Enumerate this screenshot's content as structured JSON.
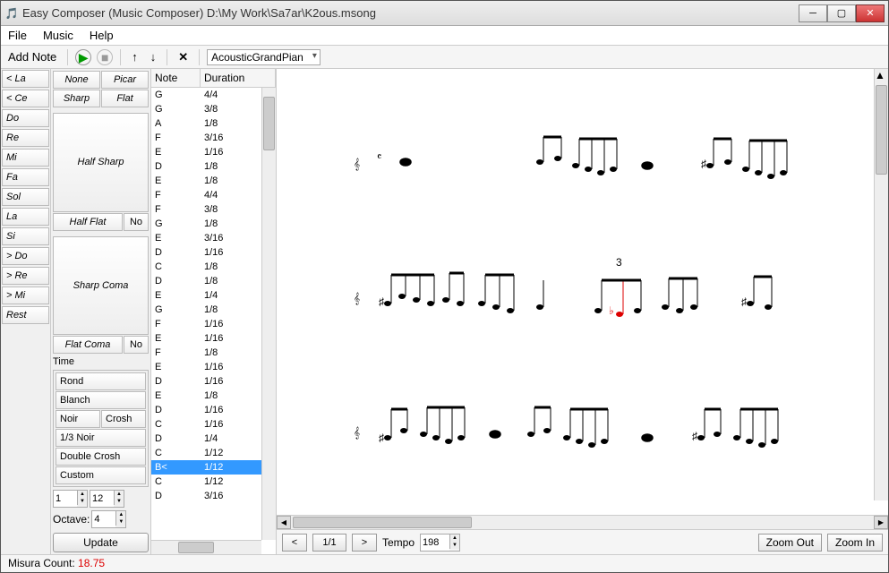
{
  "window": {
    "title": "Easy Composer (Music Composer) D:\\My Work\\Sa7ar\\K2ous.msong"
  },
  "menu": {
    "file": "File",
    "music": "Music",
    "help": "Help"
  },
  "toolbar": {
    "add_note": "Add Note",
    "instrument": "AcousticGrandPian"
  },
  "notes_left": [
    "< La",
    "< Ce",
    "Do",
    "Re",
    "Mi",
    "Fa",
    "Sol",
    "La",
    "Si",
    "> Do",
    "> Re",
    "> Mi",
    "Rest"
  ],
  "props": {
    "none": "None",
    "picar": "Picar",
    "sharp": "Sharp",
    "flat": "Flat",
    "half_sharp": "Half Sharp",
    "half_flat": "Half Flat",
    "no": "No",
    "sharp_coma": "Sharp Coma",
    "flat_coma": "Flat Coma",
    "time_label": "Time",
    "time_items": [
      "Rond",
      "Blanch"
    ],
    "time_row": [
      "Noir",
      "Crosh"
    ],
    "time_items2": [
      "1/3 Noir",
      "Double Crosh",
      "Custom"
    ],
    "num1": "1",
    "num2": "12",
    "octave_label": "Octave:",
    "octave": "4",
    "update": "Update"
  },
  "table": {
    "col_note": "Note",
    "col_dur": "Duration",
    "rows": [
      {
        "n": "G",
        "d": "4/4"
      },
      {
        "n": "G",
        "d": "3/8"
      },
      {
        "n": "A",
        "d": "1/8"
      },
      {
        "n": "F",
        "d": "3/16"
      },
      {
        "n": "E",
        "d": "1/16"
      },
      {
        "n": "D",
        "d": "1/8"
      },
      {
        "n": "E",
        "d": "1/8"
      },
      {
        "n": "F",
        "d": "4/4"
      },
      {
        "n": "F",
        "d": "3/8"
      },
      {
        "n": "G",
        "d": "1/8"
      },
      {
        "n": "E",
        "d": "3/16"
      },
      {
        "n": "D",
        "d": "1/16"
      },
      {
        "n": "C",
        "d": "1/8"
      },
      {
        "n": "D",
        "d": "1/8"
      },
      {
        "n": "E",
        "d": "1/4"
      },
      {
        "n": "G",
        "d": "1/8"
      },
      {
        "n": "F",
        "d": "1/16"
      },
      {
        "n": "E",
        "d": "1/16"
      },
      {
        "n": "F",
        "d": "1/8"
      },
      {
        "n": "E",
        "d": "1/16"
      },
      {
        "n": "D",
        "d": "1/16"
      },
      {
        "n": "E",
        "d": "1/8"
      },
      {
        "n": "D",
        "d": "1/16"
      },
      {
        "n": "C",
        "d": "1/16"
      },
      {
        "n": "D",
        "d": "1/4"
      },
      {
        "n": "C",
        "d": "1/12"
      },
      {
        "n": "B<",
        "d": "1/12",
        "sel": true
      },
      {
        "n": "C",
        "d": "1/12"
      },
      {
        "n": "D",
        "d": "3/16"
      }
    ]
  },
  "bottom": {
    "page": "1/1",
    "tempo_label": "Tempo",
    "tempo": "198",
    "zoom_out": "Zoom Out",
    "zoom_in": "Zoom In"
  },
  "status": {
    "label": "Misura Count:  ",
    "value": "18.75"
  }
}
